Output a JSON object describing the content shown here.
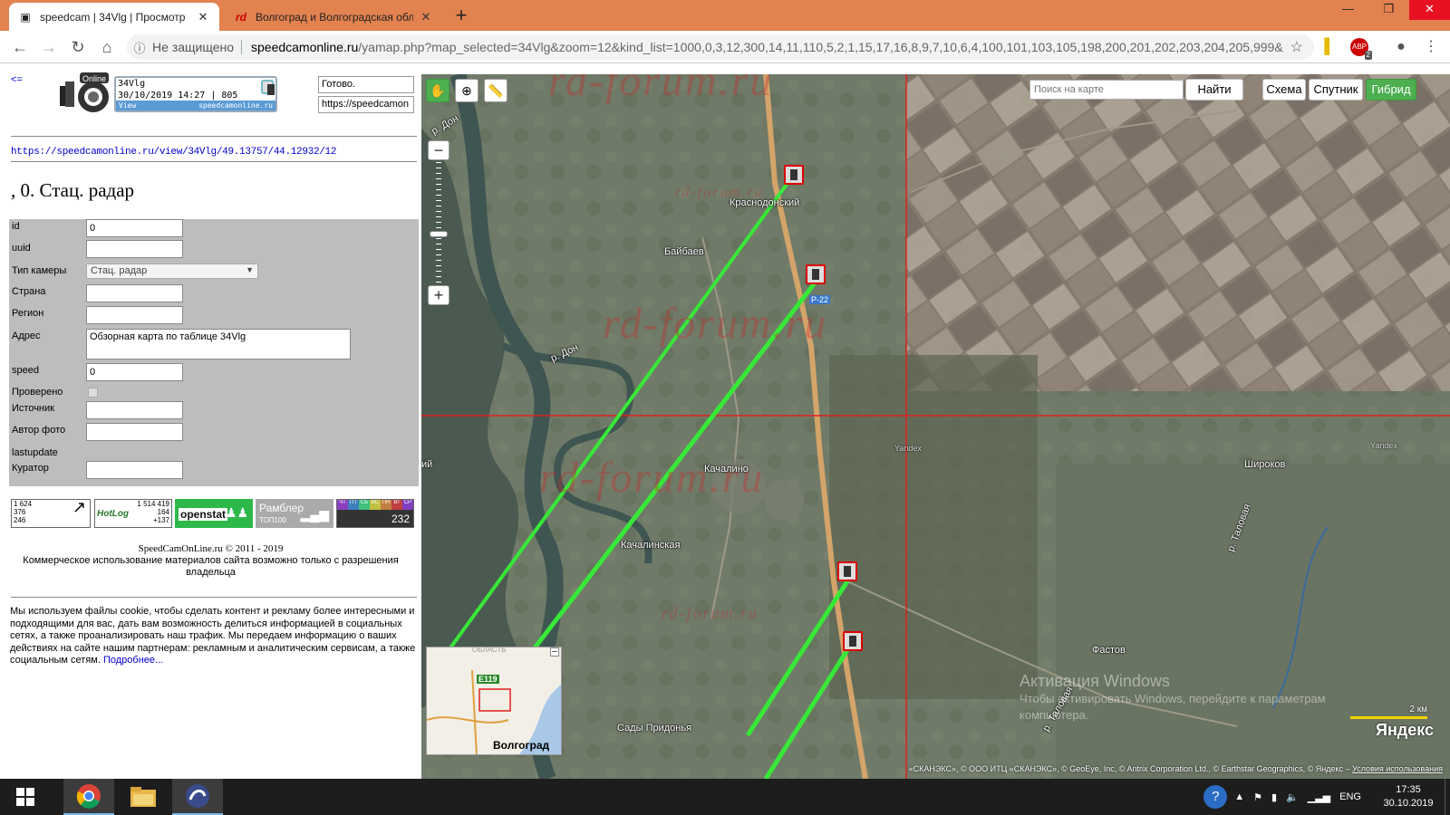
{
  "browser": {
    "tabs": [
      {
        "title": "speedcam | 34Vlg | Просмотр",
        "active": true
      },
      {
        "title": "Волгоград и Волгоградская обл",
        "active": false
      }
    ],
    "address": {
      "security": "Не защищено",
      "host": "speedcamonline.ru",
      "path": "/yamap.php?map_selected=34Vlg&zoom=12&kind_list=1000,0,3,12,300,14,11,110,5,2,1,15,17,16,8,9,7,10,6,4,100,101,103,105,198,200,201,202,203,204,205,999&"
    },
    "extensions": {
      "abp_badge": "2"
    }
  },
  "left": {
    "back_link": "<=",
    "info": {
      "code": "34Vlg",
      "datetime": "30/10/2019 14:27 | 805",
      "view": "View",
      "site": "speedcamonline.ru"
    },
    "status_box": "Готово.",
    "url_box": "https://speedcamon",
    "permalink": "https://speedcamonline.ru/view/34Vlg/49.13757/44.12932/12",
    "title": ", 0. Стац. радар",
    "form": {
      "id_label": "id",
      "id_value": "0",
      "uuid_label": "uuid",
      "uuid_value": "",
      "camtype_label": "Тип камеры",
      "camtype_value": "Стац. радар",
      "country_label": "Страна",
      "country_value": "",
      "region_label": "Регион",
      "region_value": "",
      "address_label": "Адрес",
      "address_value": "Обзорная карта по таблице 34Vlg",
      "speed_label": "speed",
      "speed_value": "0",
      "checked_label": "Проверено",
      "source_label": "Источник",
      "source_value": "",
      "photo_label": "Автор фото",
      "photo_value": "",
      "lastupdate_label": "lastupdate",
      "curator_label": "Куратор",
      "curator_value": ""
    },
    "counters": {
      "c1": [
        "1 624",
        "376",
        "246"
      ],
      "hotlog": {
        "name": "HotLog",
        "v1": "1 514 419",
        "v2": "164",
        "v3": "+137"
      },
      "openstat": "openstat",
      "rambler": {
        "name": "Рамблер",
        "sub": "ТОП100"
      },
      "stat": {
        "days": [
          "ЧТ",
          "ПТ",
          "СБ",
          "ВС",
          "ПН",
          "ВТ",
          "СР"
        ],
        "value": "232"
      }
    },
    "copyright": "SpeedCamOnLine.ru © 2011 - 2019",
    "commercial": "Коммерческое использование материалов сайта возможно только с разрешения владельца",
    "cookie_text": "Мы используем файлы cookie, чтобы сделать контент и рекламу более интересными и подходящими для вас, дать вам возможность делиться информацией в социальных сетях, а также проанализировать наш трафик. Мы передаем информацию о ваших действиях на сайте нашим партнерам: рекламным и аналитическим сервисам, а также социальным сетям.",
    "cookie_link": "Подробнее..."
  },
  "map": {
    "search_placeholder": "Поиск на карте",
    "find_button": "Найти",
    "layers": [
      "Схема",
      "Спутник",
      "Гибрид"
    ],
    "active_layer": "Гибрид",
    "watermark": "rd-forum.ru",
    "places": {
      "krasnodonsky": "Краснодонский",
      "baybaev": "Байбаев",
      "kachalino": "Качалино",
      "kachalinskaya": "Качалинская",
      "shirokov": "Широков",
      "fastov": "Фастов",
      "sady": "Сады Придонья",
      "volgograd": "Волгоград"
    },
    "rivers": {
      "don1": "р. Дон",
      "don2": "р. Дон",
      "talovaya1": "р. Таловая",
      "talovaya2": "р. Таловая"
    },
    "road": "Р-22",
    "yandex_small": "Yandex",
    "left_edge": "ий",
    "minimap": {
      "region": "ОБЛАСТЬ",
      "route": "E119",
      "city": "Волгоград"
    },
    "activation_title": "Активация Windows",
    "activation_text": "Чтобы активировать Windows, перейдите к параметрам компьютера.",
    "scale": "2 км",
    "yandex_logo": "Яндекс",
    "attribution": "«СКАНЭКС», © ООО ИТЦ «СКАНЭКС», © GeoEye, Inc, © Antrix Corporation Ltd., © Earthstar Geographics, © Яндекс –",
    "terms": "Условия использования"
  },
  "taskbar": {
    "lang": "ENG",
    "time": "17:35",
    "date": "30.10.2019"
  },
  "colors": {
    "tabbar": "#e2824f",
    "active_layer": "#4caf50",
    "track": "#38e838"
  }
}
